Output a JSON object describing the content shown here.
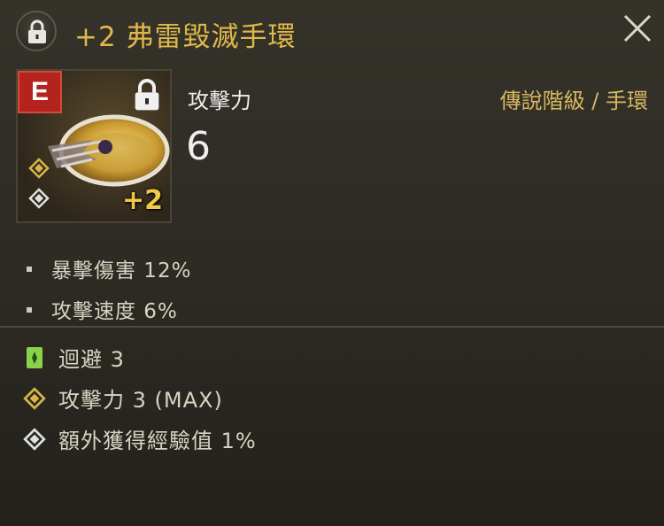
{
  "item": {
    "title": "+2 弗雷毀滅手環",
    "grade_letter": "E",
    "enhance": "+2",
    "type": "傳說階級 / 手環",
    "main_stat_label": "攻擊力",
    "main_stat_value": "6"
  },
  "substats": [
    {
      "label": "暴擊傷害 12%"
    },
    {
      "label": "攻擊速度 6%"
    }
  ],
  "extras": [
    {
      "icon": "green-card-icon",
      "label": "迴避 3"
    },
    {
      "icon": "gold-diamond-icon",
      "label": "攻擊力 3 (MAX)"
    },
    {
      "icon": "silver-diamond-icon",
      "label": "額外獲得經驗值 1%"
    }
  ],
  "colors": {
    "title": "#e0b84a",
    "grade_badge": "#b5231e",
    "type_text": "#d8b860",
    "gold": "#d9b54a",
    "green": "#8ad24a"
  }
}
